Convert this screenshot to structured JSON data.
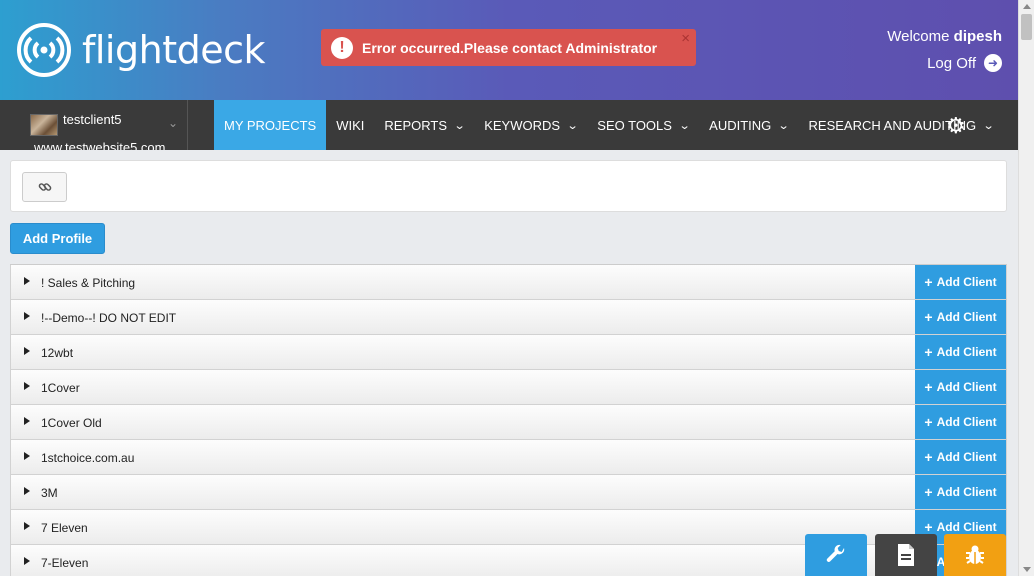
{
  "header": {
    "logo_text": "flightdeck",
    "alert_text": "Error occurred.Please contact Administrator",
    "alert_icon": "!",
    "alert_close": "×",
    "welcome_prefix": "Welcome",
    "username": "dipesh",
    "logoff_label": "Log Off"
  },
  "client": {
    "name": "testclient5",
    "website": "www.testwebsite5.com"
  },
  "nav": {
    "items": [
      {
        "label": "MY PROJECTS",
        "active": true,
        "dropdown": false
      },
      {
        "label": "WIKI",
        "active": false,
        "dropdown": false
      },
      {
        "label": "REPORTS",
        "active": false,
        "dropdown": true
      },
      {
        "label": "KEYWORDS",
        "active": false,
        "dropdown": true
      },
      {
        "label": "SEO TOOLS",
        "active": false,
        "dropdown": true
      },
      {
        "label": "AUDITING",
        "active": false,
        "dropdown": true
      },
      {
        "label": "RESEARCH AND AUDITING",
        "active": false,
        "dropdown": true
      }
    ]
  },
  "toolbar": {
    "add_profile_label": "Add Profile"
  },
  "profiles": {
    "add_client_label": "Add Client",
    "rows": [
      {
        "label": "! Sales & Pitching"
      },
      {
        "label": "!--Demo--! DO NOT EDIT"
      },
      {
        "label": "12wbt"
      },
      {
        "label": "1Cover"
      },
      {
        "label": "1Cover Old"
      },
      {
        "label": "1stchoice.com.au"
      },
      {
        "label": "3M"
      },
      {
        "label": "7 Eleven"
      },
      {
        "label": "7-Eleven"
      }
    ]
  },
  "colors": {
    "accent": "#2f9de0",
    "nav_bg": "#3a3a3a",
    "alert": "#d9534f",
    "bug_button": "#f2a012"
  }
}
